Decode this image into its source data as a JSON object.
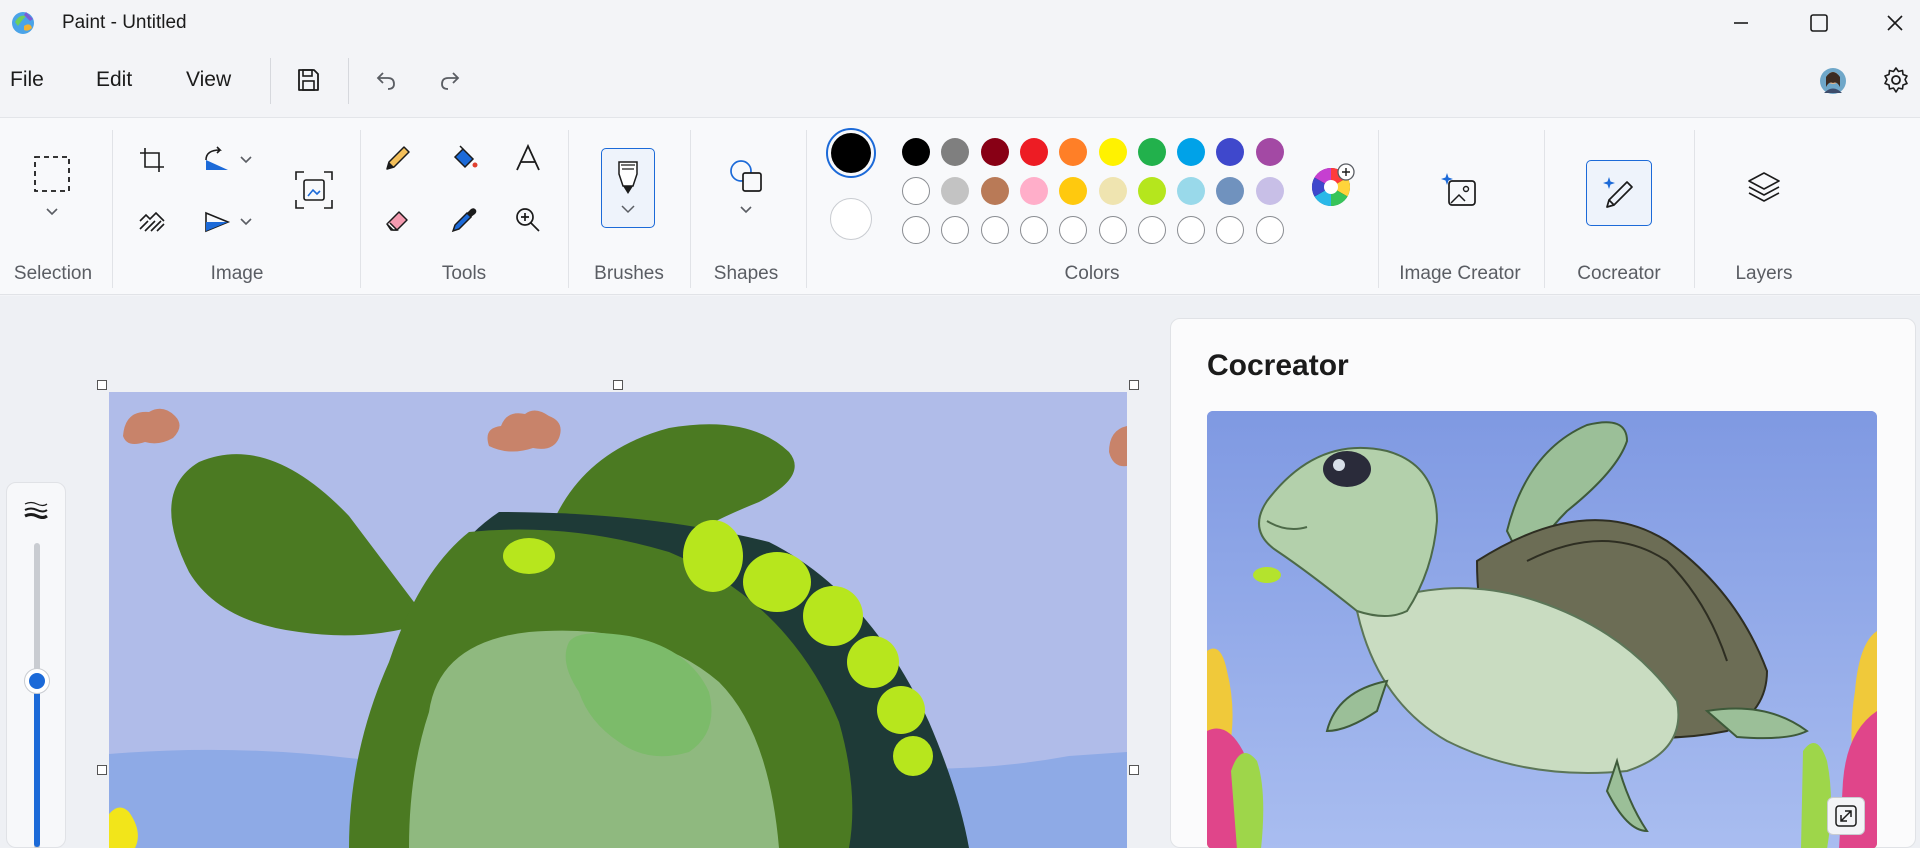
{
  "window": {
    "title": "Paint - Untitled",
    "controls": [
      "minimize",
      "maximize",
      "close"
    ]
  },
  "menu": {
    "file": "File",
    "edit": "Edit",
    "view": "View"
  },
  "ribbon": {
    "groups": {
      "selection": "Selection",
      "image": "Image",
      "tools": "Tools",
      "brushes": "Brushes",
      "shapes": "Shapes",
      "colors": "Colors",
      "image_creator": "Image Creator",
      "cocreator": "Cocreator",
      "layers": "Layers"
    },
    "colors": {
      "primary": "#000000",
      "secondary": "#ffffff",
      "row1": [
        "#000000",
        "#7f7f7f",
        "#880015",
        "#ed1c24",
        "#ff7f27",
        "#fff200",
        "#22b14c",
        "#00a2e8",
        "#3f48cc",
        "#a349a4"
      ],
      "row2": [
        "#ffffff",
        "#c3c3c3",
        "#b97a57",
        "#ffaec9",
        "#ffc90e",
        "#efe4b0",
        "#b5e61d",
        "#99d9ea",
        "#7092be",
        "#c8bfe7"
      ]
    }
  },
  "cocreator_panel": {
    "title": "Cocreator"
  },
  "zoom": {
    "level": 0.55
  },
  "icons": {
    "app": "paint-app-icon",
    "save": "save-icon",
    "undo": "undo-icon",
    "redo": "redo-icon",
    "settings": "gear-icon",
    "profile": "avatar"
  }
}
